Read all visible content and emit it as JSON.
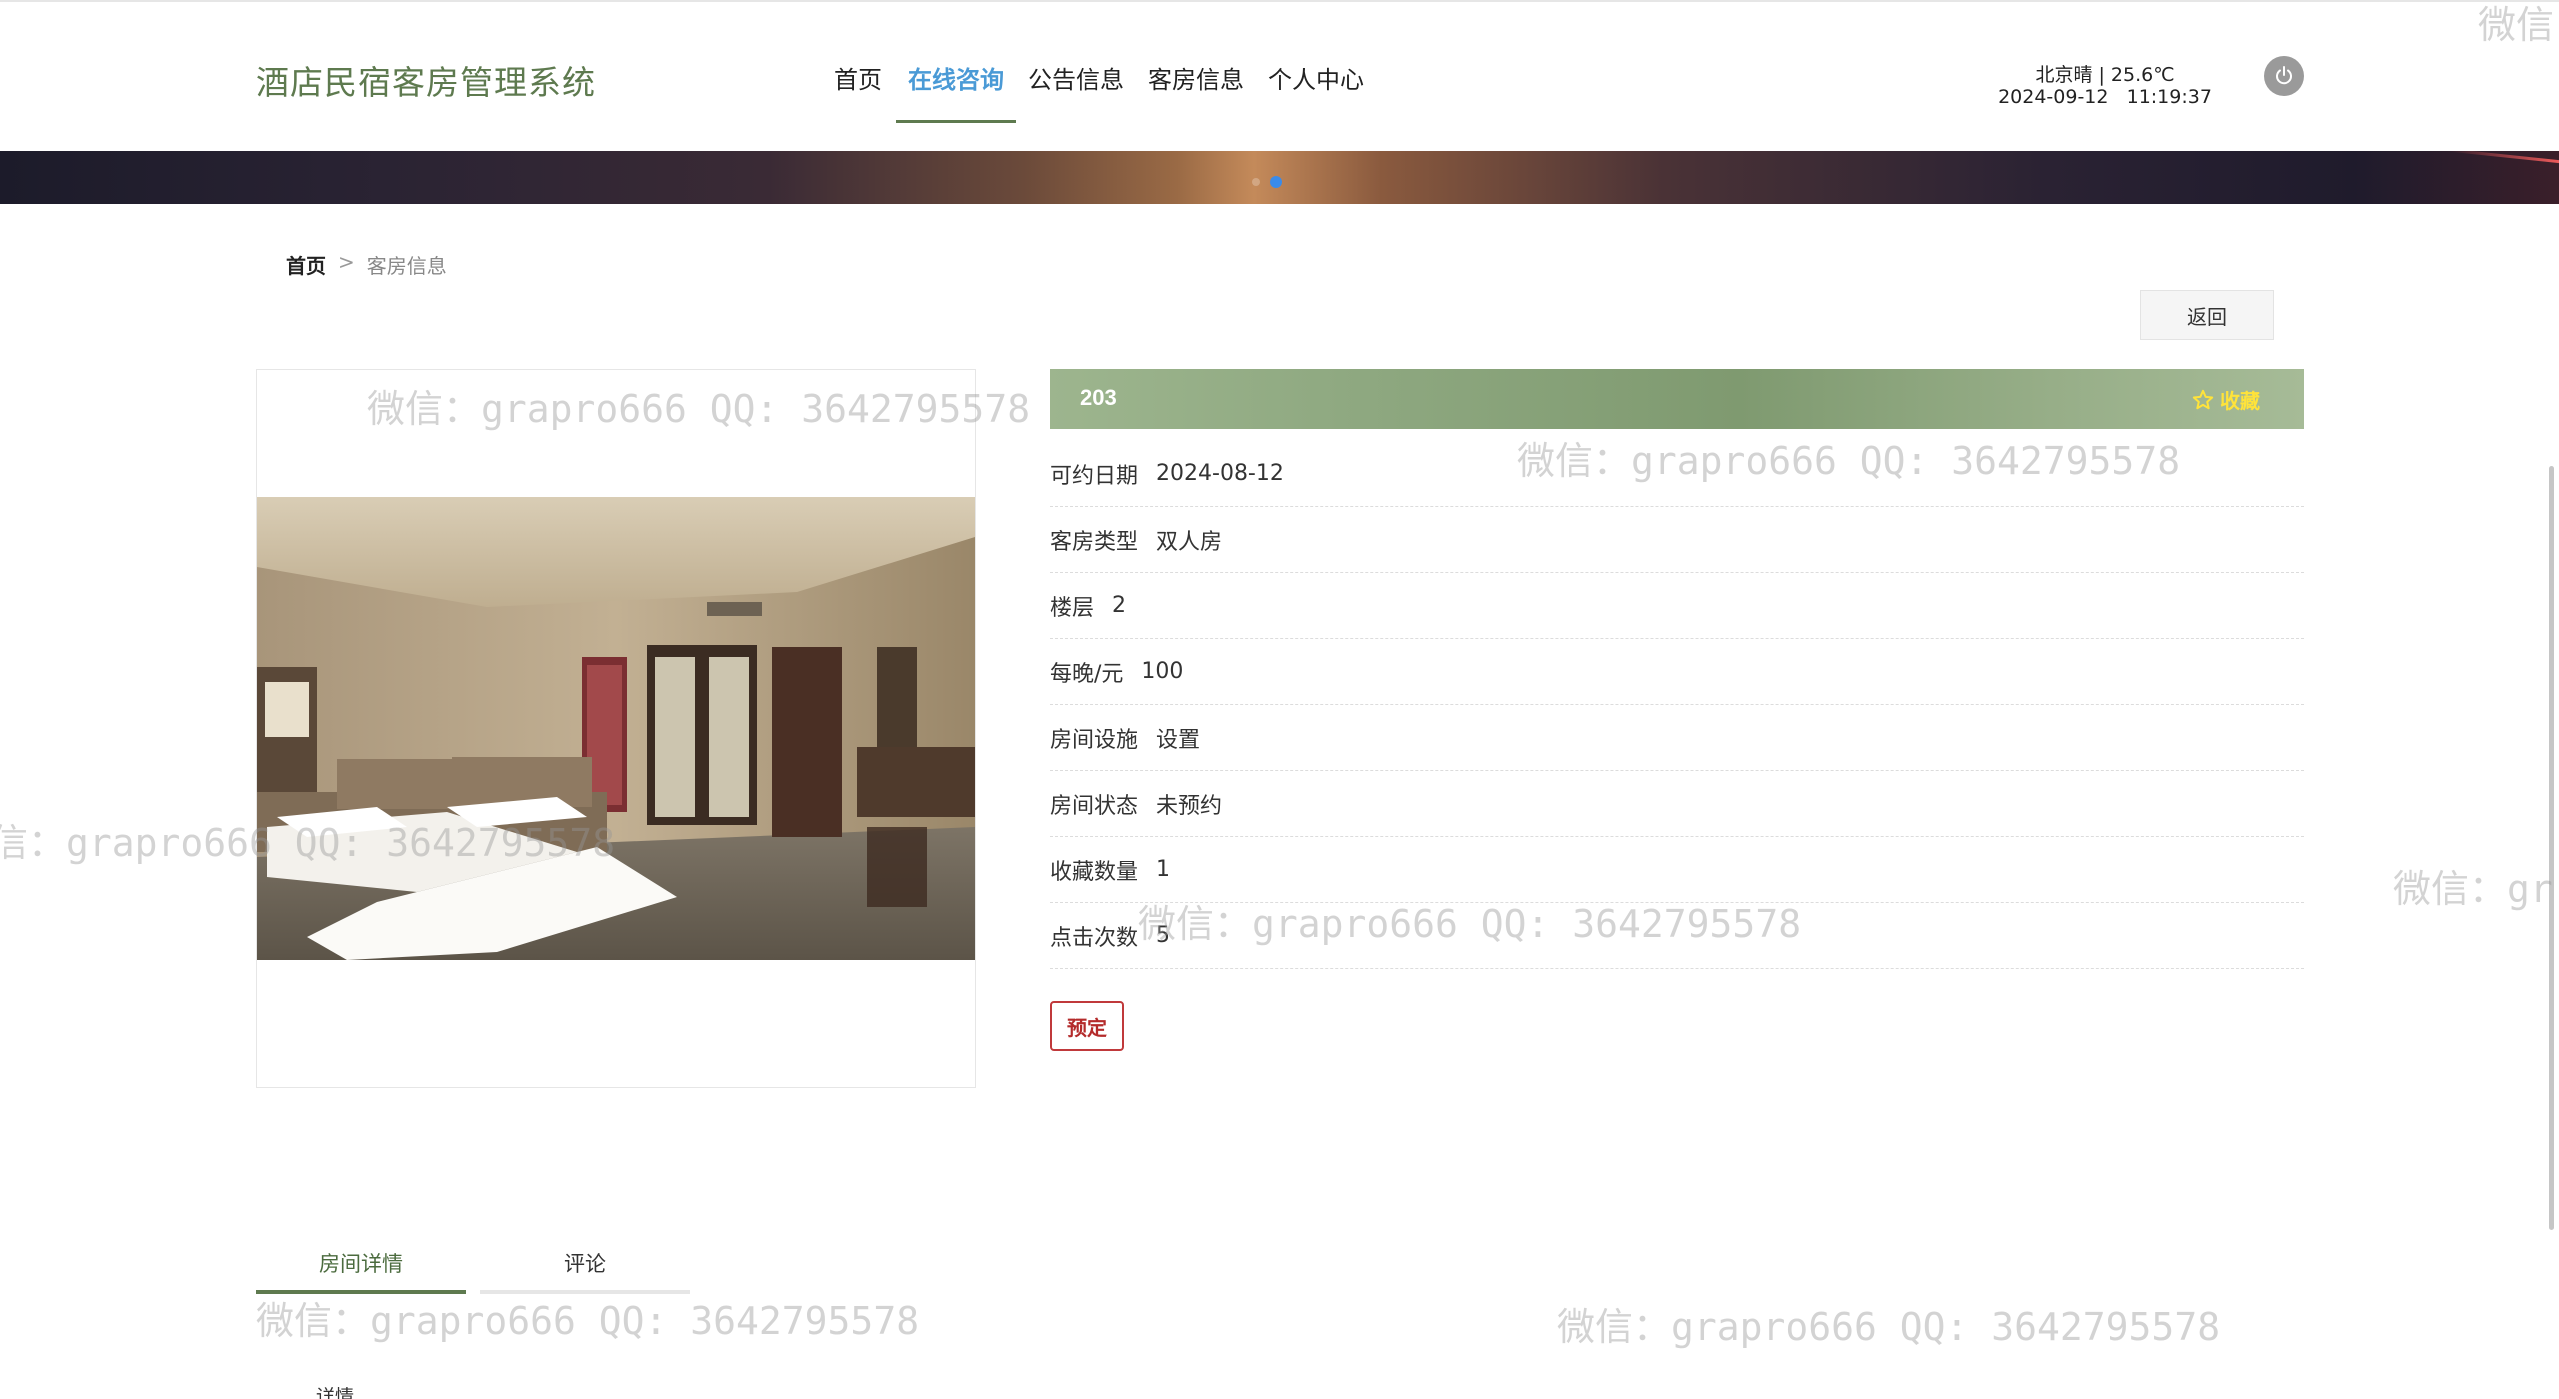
{
  "header": {
    "logo": "酒店民宿客房管理系统",
    "nav": [
      "首页",
      "在线咨询",
      "公告信息",
      "客房信息",
      "个人中心"
    ],
    "active_nav": 1,
    "weather_line": "北京晴 | 25.6℃",
    "datetime_line": "2024-09-12   11:19:37",
    "power_icon": "power-icon"
  },
  "banner": {
    "slides": 2,
    "active_slide": 1,
    "dot_color": "#3a8bea"
  },
  "breadcrumb": {
    "home": "首页",
    "separator": ">",
    "current": "客房信息"
  },
  "back_label": "返回",
  "room": {
    "number": "203",
    "favorite_label": "收藏",
    "fields": [
      {
        "label": "可约日期",
        "value": "2024-08-12"
      },
      {
        "label": "客房类型",
        "value": "双人房"
      },
      {
        "label": "楼层",
        "value": "2"
      },
      {
        "label": "每晚/元",
        "value": "100"
      },
      {
        "label": "房间设施",
        "value": "设置"
      },
      {
        "label": "房间状态",
        "value": "未预约"
      },
      {
        "label": "收藏数量",
        "value": "1"
      },
      {
        "label": "点击次数",
        "value": "5"
      }
    ],
    "book_label": "预定"
  },
  "tabs": [
    "房间详情",
    "评论"
  ],
  "active_tab": 0,
  "tab_content_label": "详情",
  "watermark": "微信：grapro666 QQ: 3642795578",
  "watermark_fragments": [
    "微信",
    "微信：gr",
    "信：grapro666 QQ: 3642795578"
  ],
  "colors": {
    "brand": "#5e7a4f",
    "nav_active": "#4a9ad6",
    "favorite": "#ffe33a",
    "book": "#b42b2b"
  }
}
